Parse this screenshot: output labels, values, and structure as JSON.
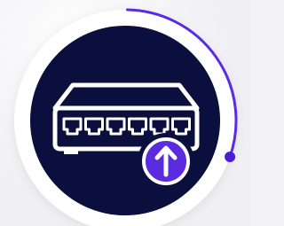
{
  "icon": {
    "name": "network-switch-upgrade-icon",
    "device": "network-switch-icon",
    "badge": "arrow-up-icon",
    "port_count": 6
  },
  "progress": {
    "fraction": 0.3
  },
  "colors": {
    "background": "#f4f4f6",
    "ring": "#ffffff",
    "disc": "#0a0f3d",
    "device_stroke": "#ffffff",
    "badge": "#5b2be0",
    "progress_arc": "#5b2be0",
    "progress_dot": "#4b1fd0"
  }
}
